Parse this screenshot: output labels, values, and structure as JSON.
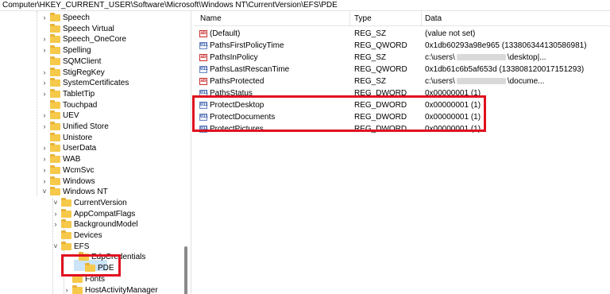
{
  "address_bar": {
    "path": "Computer\\HKEY_CURRENT_USER\\Software\\Microsoft\\Windows NT\\CurrentVersion\\EFS\\PDE"
  },
  "tree": {
    "items": [
      {
        "label": "Speech",
        "chevron": ">"
      },
      {
        "label": "Speech Virtual",
        "chevron": ""
      },
      {
        "label": "Speech_OneCore",
        "chevron": ">"
      },
      {
        "label": "Spelling",
        "chevron": ">"
      },
      {
        "label": "SQMClient",
        "chevron": ""
      },
      {
        "label": "StigRegKey",
        "chevron": ">"
      },
      {
        "label": "SystemCertificates",
        "chevron": ">"
      },
      {
        "label": "TabletTip",
        "chevron": ">"
      },
      {
        "label": "Touchpad",
        "chevron": ""
      },
      {
        "label": "UEV",
        "chevron": ">"
      },
      {
        "label": "Unified Store",
        "chevron": ">"
      },
      {
        "label": "Unistore",
        "chevron": ""
      },
      {
        "label": "UserData",
        "chevron": ">"
      },
      {
        "label": "WAB",
        "chevron": ">"
      },
      {
        "label": "WcmSvc",
        "chevron": ">"
      },
      {
        "label": "Windows",
        "chevron": ">"
      },
      {
        "label": "Windows NT",
        "chevron": "v"
      },
      {
        "label": "CurrentVersion",
        "chevron": "v"
      },
      {
        "label": "AppCompatFlags",
        "chevron": ">"
      },
      {
        "label": "BackgroundModel",
        "chevron": ">"
      },
      {
        "label": "Devices",
        "chevron": ""
      },
      {
        "label": "EFS",
        "chevron": "v"
      },
      {
        "label": "EdpCredentials",
        "chevron": ""
      },
      {
        "label": "PDE",
        "chevron": ""
      },
      {
        "label": "Fonts",
        "chevron": ""
      },
      {
        "label": "HostActivityManager",
        "chevron": ">"
      }
    ]
  },
  "list": {
    "headers": {
      "name": "Name",
      "type": "Type",
      "data": "Data"
    },
    "rows": [
      {
        "name": "(Default)",
        "type": "REG_SZ",
        "data": "(value not set)",
        "icon": "string-value-icon"
      },
      {
        "name": "PathsFirstPolicyTime",
        "type": "REG_QWORD",
        "data": "0x1db60293a98e965 (133806344130586981)",
        "icon": "binary-value-icon"
      },
      {
        "name": "PathsInPolicy",
        "type": "REG_SZ",
        "data_pre": "c:\\users\\",
        "data_post": "\\desktop|...",
        "icon": "string-value-icon"
      },
      {
        "name": "PathsLastRescanTime",
        "type": "REG_QWORD",
        "data": "0x1db61c6b5af653d (133808120017151293)",
        "icon": "binary-value-icon"
      },
      {
        "name": "PathsProtected",
        "type": "REG_SZ",
        "data_pre": "c:\\users\\",
        "data_post": "\\docume...",
        "icon": "string-value-icon"
      },
      {
        "name": "PathsStatus",
        "type": "REG_DWORD",
        "data": "0x00000001 (1)",
        "icon": "binary-value-icon"
      },
      {
        "name": "ProtectDesktop",
        "type": "REG_DWORD",
        "data": "0x00000001 (1)",
        "icon": "binary-value-icon"
      },
      {
        "name": "ProtectDocuments",
        "type": "REG_DWORD",
        "data": "0x00000001 (1)",
        "icon": "binary-value-icon"
      },
      {
        "name": "ProtectPictures",
        "type": "REG_DWORD",
        "data": "0x00000001 (1)",
        "icon": "binary-value-icon"
      }
    ]
  },
  "icons": {
    "string_glyph": "ab",
    "binary_glyph": "011"
  },
  "colors": {
    "highlight_box": "#e0101f",
    "selection": "#cce4f7",
    "folder": "#f6c94a"
  }
}
